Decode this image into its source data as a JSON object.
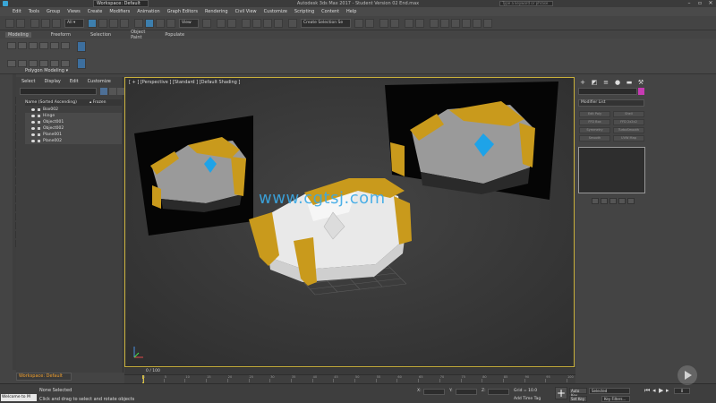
{
  "window": {
    "workspace": "Workspace: Default",
    "title": "Autodesk 3ds Max 2017 - Student Version    02 End.max",
    "search_placeholder": "Type a keyword or phrase"
  },
  "menu": [
    "Edit",
    "Tools",
    "Group",
    "Views",
    "Create",
    "Modifiers",
    "Animation",
    "Graph Editors",
    "Rendering",
    "Civil View",
    "Customize",
    "Scripting",
    "Content",
    "Help"
  ],
  "toolbar": {
    "filter": "View",
    "selection_set": "Create Selection Se"
  },
  "ribbon": {
    "tabs": [
      "Modeling",
      "Freeform",
      "Selection",
      "Object Paint",
      "Populate"
    ],
    "active_tab": "Modeling",
    "group_label": "Polygon Modeling ▾"
  },
  "scene_explorer": {
    "tabs": [
      "Select",
      "Display",
      "Edit",
      "Customize"
    ],
    "header_name": "Name (Sorted Ascending)",
    "header_frozen": "▴ Frozen",
    "rows": [
      "Box002",
      "Hinge",
      "Object001",
      "Object002",
      "Plane001",
      "Plane002"
    ]
  },
  "viewport": {
    "label": "[ + ] [Perspective ] [Standard ] [Default Shading ]"
  },
  "command_panel": {
    "modifier_list": "Modifier List",
    "buttons": [
      "Edit Poly",
      "Shell",
      "FFD Box",
      "FFD 2x2x2",
      "Symmetry",
      "TurboSmooth",
      "Smooth",
      "UVW Map",
      "Unwrap UVW"
    ]
  },
  "bottom": {
    "workspace": "Workspace: Default",
    "time_counter": "0 / 100",
    "timeline_ticks": [
      "0",
      "5",
      "10",
      "15",
      "20",
      "25",
      "30",
      "35",
      "40",
      "45",
      "50",
      "55",
      "60",
      "65",
      "70",
      "75",
      "80",
      "85",
      "90",
      "95",
      "100"
    ],
    "maxscript": "Welcome to M",
    "status1": "None Selected",
    "status2": "Click and drag to select and rotate objects",
    "coord_x": "X:",
    "coord_y": "Y:",
    "coord_z": "Z:",
    "grid": "Grid = 10.0",
    "add_time_tag": "Add Time Tag",
    "auto_key": "Auto Key",
    "set_key": "Set Key",
    "key_mode": "Selected",
    "key_filters": "Key Filters...",
    "frame": "0"
  },
  "watermark": "www.cgtsj.com",
  "colors": {
    "accent_blue": "#3d7fae",
    "viewport_border": "#c9b03a",
    "gold": "#c99a1c",
    "gem": "#1ea3e8",
    "watermark": "#3aa9e6"
  }
}
